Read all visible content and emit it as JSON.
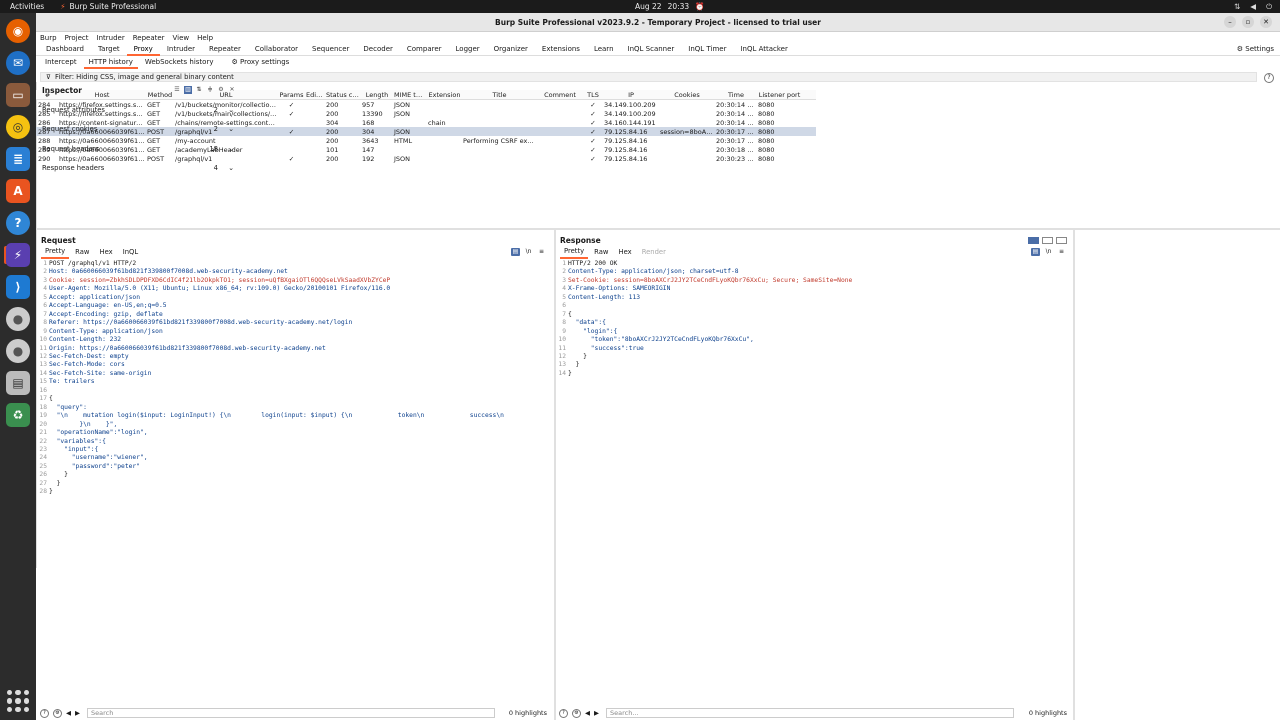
{
  "topbar": {
    "activities": "Activities",
    "app": "Burp Suite Professional",
    "date": "Aug 22",
    "time": "20:33"
  },
  "window": {
    "title": "Burp Suite Professional v2023.9.2 - Temporary Project - licensed to trial user"
  },
  "menu": [
    "Burp",
    "Project",
    "Intruder",
    "Repeater",
    "View",
    "Help"
  ],
  "main_tabs": [
    "Dashboard",
    "Target",
    "Proxy",
    "Intruder",
    "Repeater",
    "Collaborator",
    "Sequencer",
    "Decoder",
    "Comparer",
    "Logger",
    "Organizer",
    "Extensions",
    "Learn",
    "InQL Scanner",
    "InQL Timer",
    "InQL Attacker"
  ],
  "settings_label": "Settings",
  "sub_tabs": [
    "Intercept",
    "HTTP history",
    "WebSockets history"
  ],
  "proxy_settings": "Proxy settings",
  "filter": "Filter: Hiding CSS, image and general binary content",
  "table": {
    "headers": [
      "#",
      "Host",
      "Method",
      "URL",
      "Params",
      "Edited",
      "Status code",
      "Length",
      "MIME type",
      "Extension",
      "Title",
      "Comment",
      "TLS",
      "IP",
      "Cookies",
      "Time",
      "Listener port"
    ],
    "rows": [
      [
        "284",
        "https://firefox.settings.servi...",
        "GET",
        "/v1/buckets/monitor/collections/c...",
        "✓",
        "",
        "200",
        "957",
        "JSON",
        "",
        "",
        "",
        "✓",
        "34.149.100.209",
        "",
        "20:30:14 2...",
        "8080"
      ],
      [
        "285",
        "https://firefox.settings.servi...",
        "GET",
        "/v1/buckets/main/collections/nim...",
        "✓",
        "",
        "200",
        "13390",
        "JSON",
        "",
        "",
        "",
        "✓",
        "34.149.100.209",
        "",
        "20:30:14 2...",
        "8080"
      ],
      [
        "286",
        "https://content-signature-2...",
        "GET",
        "/chains/remote-settings.content-...",
        "",
        "",
        "304",
        "168",
        "",
        "chain",
        "",
        "",
        "✓",
        "34.160.144.191",
        "",
        "20:30:14 2...",
        "8080"
      ],
      [
        "287",
        "https://0a660066039f61bd8...",
        "POST",
        "/graphql/v1",
        "✓",
        "",
        "200",
        "304",
        "JSON",
        "",
        "",
        "",
        "✓",
        "79.125.84.16",
        "session=8boAX...",
        "20:30:17 2...",
        "8080"
      ],
      [
        "288",
        "https://0a660066039f61bd8...",
        "GET",
        "/my-account",
        "",
        "",
        "200",
        "3643",
        "HTML",
        "",
        "Performing CSRF ex...",
        "",
        "✓",
        "79.125.84.16",
        "",
        "20:30:17 2...",
        "8080"
      ],
      [
        "289",
        "https://0a660066039f61bd8...",
        "GET",
        "/academyLabHeader",
        "",
        "",
        "101",
        "147",
        "",
        "",
        "",
        "",
        "✓",
        "79.125.84.16",
        "",
        "20:30:18 2...",
        "8080"
      ],
      [
        "290",
        "https://0a660066039f61bd8...",
        "POST",
        "/graphql/v1",
        "✓",
        "",
        "200",
        "192",
        "JSON",
        "",
        "",
        "",
        "✓",
        "79.125.84.16",
        "",
        "20:30:23 2...",
        "8080"
      ]
    ],
    "selected_row": 3
  },
  "request": {
    "title": "Request",
    "tabs": [
      "Pretty",
      "Raw",
      "Hex",
      "InQL"
    ],
    "lines": [
      "POST /graphql/v1 HTTP/2",
      "Host: 0a660066039f61bd821f339800f7008d.web-security-academy.net",
      "Cookie: session=ZbkhSDLDPDFXD6CdIC4f21lb2OkpkTO1; session=uQfBXgaiOTl6QQQseLVkSaadXVbZYCeP",
      "User-Agent: Mozilla/5.0 (X11; Ubuntu; Linux x86_64; rv:109.0) Gecko/20100101 Firefox/116.0",
      "Accept: application/json",
      "Accept-Language: en-US,en;q=0.5",
      "Accept-Encoding: gzip, deflate",
      "Referer: https://0a660066039f61bd821f339800f7008d.web-security-academy.net/login",
      "Content-Type: application/json",
      "Content-Length: 232",
      "Origin: https://0a660066039f61bd821f339800f7008d.web-security-academy.net",
      "Sec-Fetch-Dest: empty",
      "Sec-Fetch-Mode: cors",
      "Sec-Fetch-Site: same-origin",
      "Te: trailers",
      "",
      "{",
      "  \"query\":",
      "  \"\\n    mutation login($input: LoginInput!) {\\n        login(input: $input) {\\n            token\\n            success\\n",
      "        }\\n    }\",",
      "  \"operationName\":\"login\",",
      "  \"variables\":{",
      "    \"input\":{",
      "      \"username\":\"wiener\",",
      "      \"password\":\"peter\"",
      "    }",
      "  }",
      "}"
    ],
    "search_placeholder": "Search",
    "highlights": "0 highlights"
  },
  "response": {
    "title": "Response",
    "tabs": [
      "Pretty",
      "Raw",
      "Hex",
      "Render"
    ],
    "lines": [
      "HTTP/2 200 OK",
      "Content-Type: application/json; charset=utf-8",
      "Set-Cookie: session=8boAXCrJ2JY2TCeCndFLyoKQbr76XxCu; Secure; SameSite=None",
      "X-Frame-Options: SAMEORIGIN",
      "Content-Length: 113",
      "",
      "{",
      "  \"data\":{",
      "    \"login\":{",
      "      \"token\":\"8boAXCrJ2JY2TCeCndFLyoKQbr76XxCu\",",
      "      \"success\":true",
      "    }",
      "  }",
      "}"
    ],
    "search_placeholder": "Search...",
    "highlights": "0 highlights"
  },
  "inspector": {
    "title": "Inspector",
    "sections": [
      {
        "label": "Request attributes",
        "count": "2"
      },
      {
        "label": "Request cookies",
        "count": "2"
      },
      {
        "label": "Request headers",
        "count": "18"
      },
      {
        "label": "Response headers",
        "count": "4"
      }
    ]
  },
  "colors": {
    "accent": "#ff6633",
    "selected_row": "#cfd8e6",
    "toggle_blue": "#4a6da7"
  }
}
